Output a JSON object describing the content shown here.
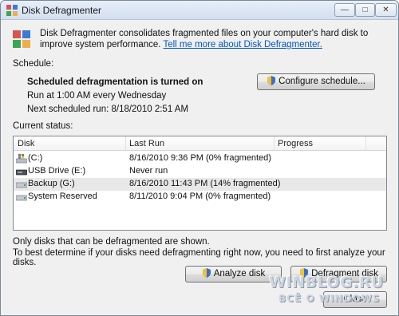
{
  "window": {
    "title": "Disk Defragmenter",
    "controls": {
      "minimize_icon": "minimize-icon",
      "maximize_icon": "maximize-icon",
      "close_icon": "close-icon"
    }
  },
  "intro": {
    "text": "Disk Defragmenter consolidates fragmented files on your computer's hard disk to improve system performance.",
    "link": "Tell me more about Disk Defragmenter."
  },
  "schedule": {
    "label": "Schedule:",
    "status": "Scheduled defragmentation is turned on",
    "run_at": "Run at 1:00 AM every Wednesday",
    "next_run": "Next scheduled run: 8/18/2010 2:51 AM",
    "configure_button": "Configure schedule..."
  },
  "current_status": {
    "label": "Current status:",
    "columns": [
      "Disk",
      "Last Run",
      "Progress"
    ],
    "rows": [
      {
        "disk": "(C:)",
        "last_run": "8/16/2010 9:36 PM (0% fragmented)",
        "progress": "",
        "icon": "windows-drive-icon",
        "selected": false
      },
      {
        "disk": "USB Drive (E:)",
        "last_run": "Never run",
        "progress": "",
        "icon": "usb-drive-icon",
        "selected": false
      },
      {
        "disk": "Backup (G:)",
        "last_run": "8/16/2010 11:43 PM (14% fragmented)",
        "progress": "",
        "icon": "hard-drive-icon",
        "selected": true
      },
      {
        "disk": "System Reserved",
        "last_run": "8/11/2010 9:04 PM (0% fragmented)",
        "progress": "",
        "icon": "hard-drive-icon",
        "selected": false
      }
    ]
  },
  "notes": {
    "line1": "Only disks that can be defragmented are shown.",
    "line2": "To best determine if your disks need defragmenting right now, you need to first analyze your disks."
  },
  "buttons": {
    "analyze": "Analyze disk",
    "defragment": "Defragment disk",
    "close": "Close"
  },
  "watermark": {
    "line1": "WINBLOG.RU",
    "line2": "ВСЁ О WINDOWS"
  },
  "colors": {
    "link": "#0055cc",
    "selection": "#e8e8e8",
    "titlebar": "#d3dff0"
  }
}
